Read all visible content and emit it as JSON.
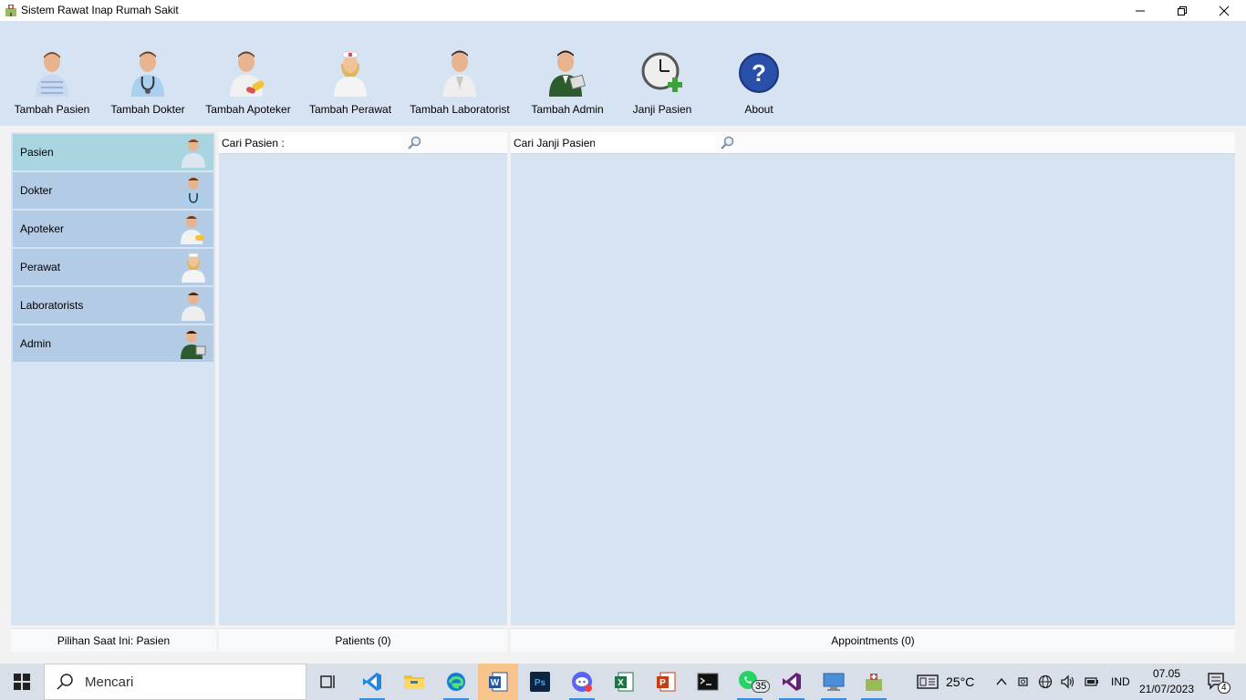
{
  "window": {
    "title": "Sistem Rawat Inap Rumah Sakit"
  },
  "toolbar": {
    "items": [
      {
        "label": "Tambah Pasien",
        "icon": "patient-icon"
      },
      {
        "label": "Tambah Dokter",
        "icon": "doctor-icon"
      },
      {
        "label": "Tambah Apoteker",
        "icon": "pharmacist-icon"
      },
      {
        "label": "Tambah Perawat",
        "icon": "nurse-icon"
      },
      {
        "label": "Tambah Laboratorist",
        "icon": "laboratorist-icon"
      },
      {
        "label": "Tambah Admin",
        "icon": "admin-icon"
      },
      {
        "label": "Janji Pasien",
        "icon": "clock-add-icon"
      },
      {
        "label": "About",
        "icon": "help-icon"
      }
    ]
  },
  "sidebar": {
    "items": [
      {
        "label": "Pasien",
        "active": true
      },
      {
        "label": "Dokter"
      },
      {
        "label": "Apoteker"
      },
      {
        "label": "Perawat"
      },
      {
        "label": "Laboratorists"
      },
      {
        "label": "Admin"
      }
    ],
    "status": "Pilihan Saat Ini: Pasien"
  },
  "patients_panel": {
    "search_label": "Cari Pasien :",
    "search_value": "",
    "status": "Patients (0)"
  },
  "appointments_panel": {
    "search_label": "Cari Janji Pasien:",
    "search_value": "",
    "status": "Appointments (0)"
  },
  "taskbar": {
    "search_placeholder": "Mencari",
    "whatsapp_badge": "35",
    "weather": "25°C",
    "language": "IND",
    "time": "07.05",
    "date": "21/07/2023",
    "notification_count": "4"
  },
  "colors": {
    "toolbar_bg": "#d6e3f2",
    "sidebar_item": "#b4cbe6",
    "sidebar_active": "#a8d5e0"
  }
}
